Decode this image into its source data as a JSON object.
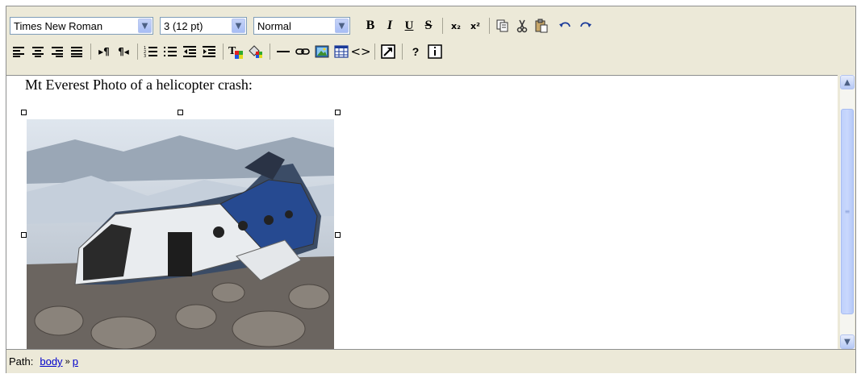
{
  "toolbar": {
    "font_family": "Times New Roman",
    "font_size": "3 (12 pt)",
    "block_format": "Normal",
    "row1_buttons": [
      {
        "name": "bold-button",
        "glyph": "B"
      },
      {
        "name": "italic-button",
        "glyph": "I"
      },
      {
        "name": "underline-button",
        "glyph": "U"
      },
      {
        "name": "strikethrough-button",
        "glyph": "S"
      }
    ],
    "subscript_glyph": "x₂",
    "superscript_glyph": "x²"
  },
  "content": {
    "text": "Mt Everest Photo of a helicopter crash:"
  },
  "status": {
    "path_label": "Path:",
    "crumbs": [
      "body",
      "p"
    ],
    "sep": "»"
  },
  "colors": {
    "toolbar_bg": "#ece9d8",
    "link": "#0000cc",
    "xp_blue": "#a7bdf5"
  }
}
